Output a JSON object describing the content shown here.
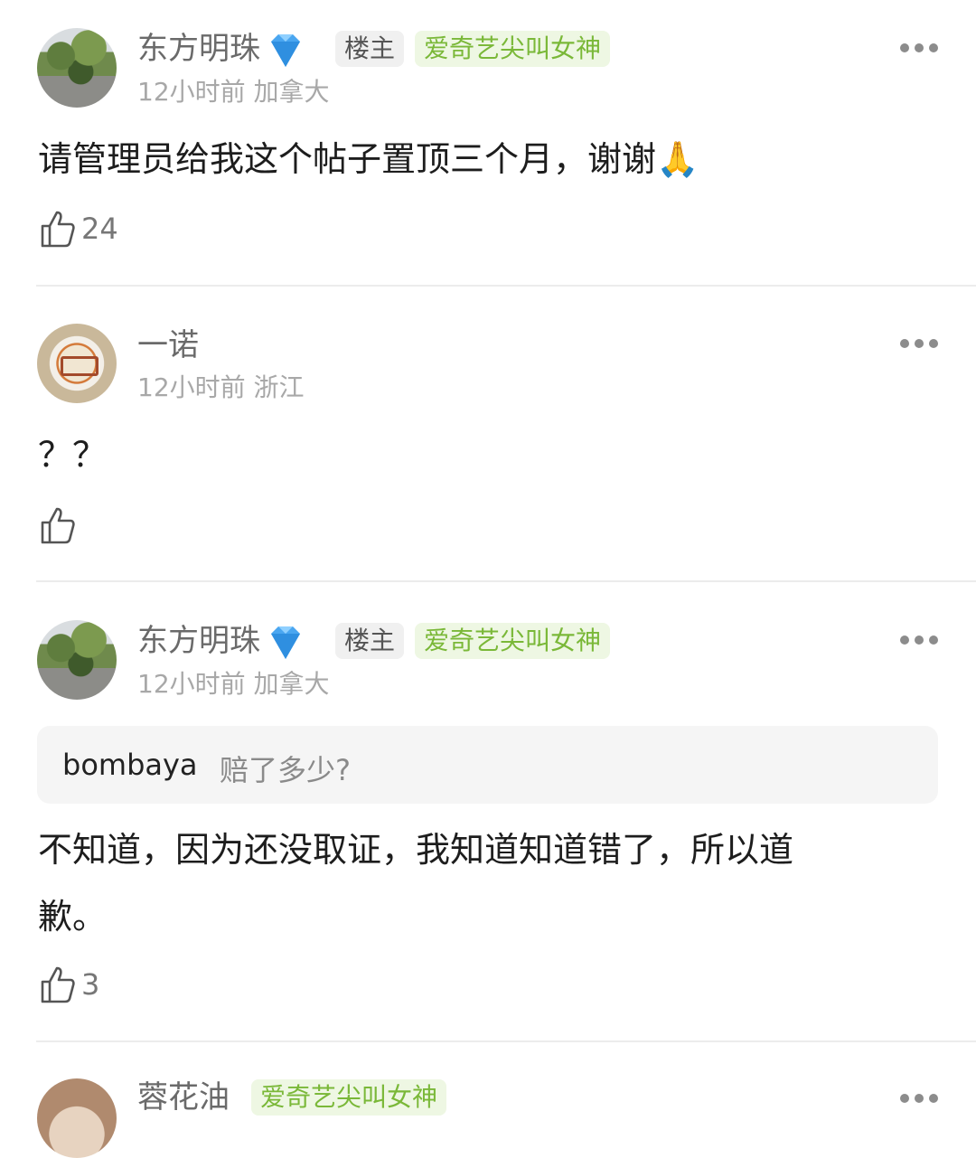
{
  "comments": [
    {
      "username": "东方明珠",
      "is_op": true,
      "op_label": "楼主",
      "tag": "爱奇艺尖叫女神",
      "time": "12小时前",
      "location": "加拿大",
      "content": "请管理员给我这个帖子置顶三个月，谢谢🙏",
      "likes": "24"
    },
    {
      "username": "一诺",
      "time": "12小时前",
      "location": "浙江",
      "content": "？？",
      "likes": ""
    },
    {
      "username": "东方明珠",
      "is_op": true,
      "op_label": "楼主",
      "tag": "爱奇艺尖叫女神",
      "time": "12小时前",
      "location": "加拿大",
      "quote": {
        "user": "bombaya",
        "text": "赔了多少?"
      },
      "content_line1": "不知道，因为还没取证，我知道知道错了，所以道",
      "content_line2": "歉。",
      "likes": "3"
    },
    {
      "username": "蓉花油",
      "tag": "爱奇艺尖叫女神"
    }
  ],
  "icons": {
    "more": "more-dots-icon",
    "like": "thumbs-up-icon",
    "diamond": "diamond-icon"
  },
  "colors": {
    "tag_green": "#7ab838",
    "tag_green_bg": "#eef7e3",
    "diamond": "#4aa6f0"
  }
}
